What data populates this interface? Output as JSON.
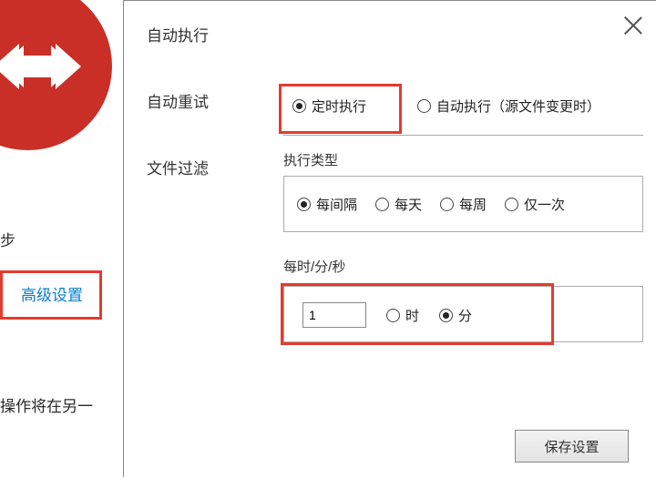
{
  "left": {
    "sync_label": "步",
    "advanced_label": "高级设置",
    "bottom_text": "操作将在另一"
  },
  "dialog": {
    "tabs": [
      "自动执行",
      "自动重试",
      "文件过滤"
    ],
    "mode": {
      "scheduled": "定时执行",
      "auto": "自动执行（源文件变更时）"
    },
    "exec_type": {
      "title": "执行类型",
      "options": [
        "每间隔",
        "每天",
        "每周",
        "仅一次"
      ]
    },
    "unit": {
      "title": "每时/分/秒",
      "value": "1",
      "hour": "时",
      "minute": "分"
    },
    "save_label": "保存设置"
  },
  "annotations": {
    "highlight_color": "#e33b2f"
  }
}
